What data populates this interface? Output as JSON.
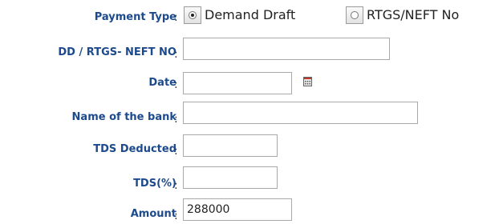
{
  "form": {
    "payment_type": {
      "label": "Payment Type",
      "colon": ":",
      "options": [
        {
          "label": "Demand Draft",
          "selected": true
        },
        {
          "label": "RTGS/NEFT No",
          "selected": false
        }
      ]
    },
    "dd_rtgs_neft_no": {
      "label": "DD / RTGS- NEFT NO",
      "colon": ":",
      "value": ""
    },
    "date": {
      "label": "Date",
      "colon": ":",
      "value": "",
      "icon": "calendar-icon"
    },
    "bank_name": {
      "label": "Name of the bank",
      "colon": ":",
      "value": ""
    },
    "tds_deducted": {
      "label": "TDS Deducted",
      "colon": ":",
      "value": ""
    },
    "tds_percent": {
      "label": "TDS(%)",
      "colon": ":",
      "value": ""
    },
    "amount": {
      "label": "Amount",
      "colon": ":",
      "value": "288000"
    }
  },
  "colors": {
    "label": "#1c4a8c",
    "field_border": "#a9a9a9"
  }
}
